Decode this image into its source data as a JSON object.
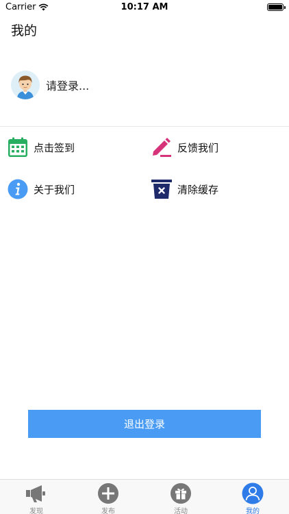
{
  "status_bar": {
    "carrier": "Carrier",
    "time": "10:17 AM"
  },
  "header": {
    "title": "我的"
  },
  "profile": {
    "name": "请登录..."
  },
  "menu": {
    "checkin": "点击签到",
    "feedback": "反馈我们",
    "about": "关于我们",
    "clear_cache": "清除缓存"
  },
  "logout": {
    "label": "退出登录"
  },
  "tabs": [
    {
      "label": "发现",
      "icon": "megaphone-icon"
    },
    {
      "label": "发布",
      "icon": "plus-circle-icon"
    },
    {
      "label": "活动",
      "icon": "gift-icon"
    },
    {
      "label": "我的",
      "icon": "user-circle-icon",
      "active": true
    }
  ],
  "colors": {
    "accent": "#4a9bf4",
    "tab_active": "#2f7ce8",
    "calendar_green": "#27ae60",
    "pencil_pink": "#d6337a",
    "info_blue": "#4a9bf4",
    "trash_navy": "#1f2a6b"
  }
}
